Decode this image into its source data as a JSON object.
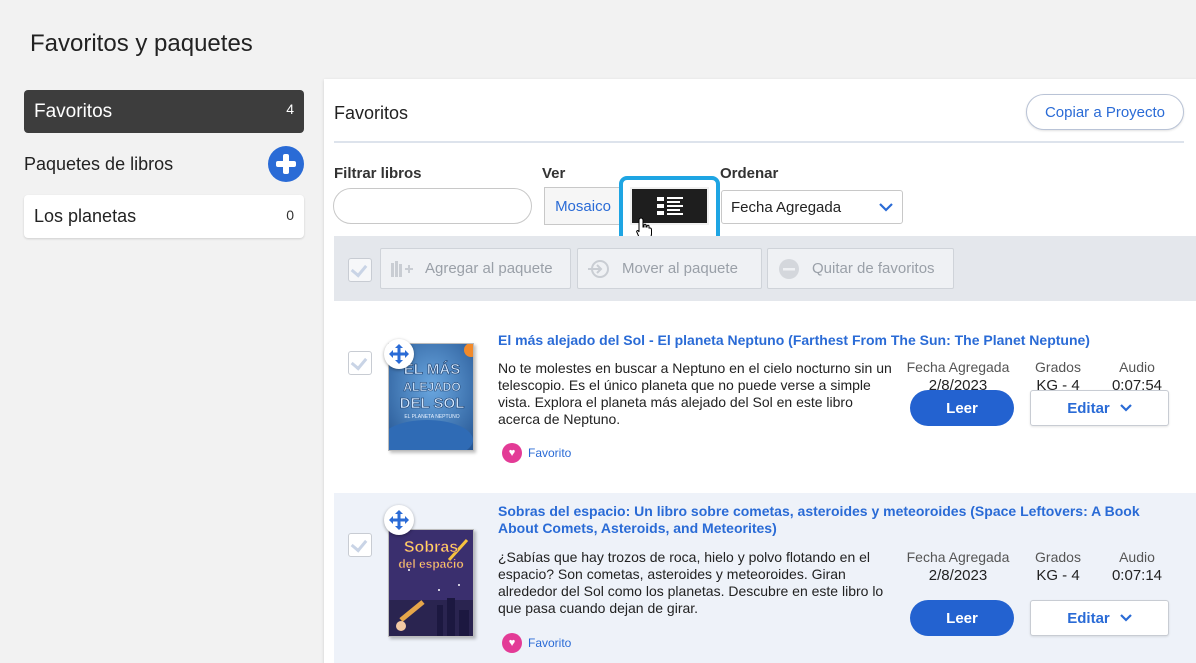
{
  "page": {
    "title": "Favoritos y paquetes"
  },
  "sidebar": {
    "favorites": {
      "label": "Favoritos",
      "count": "4"
    },
    "packages_header": "Paquetes de libros",
    "packages": [
      {
        "label": "Los planetas",
        "count": "0"
      }
    ]
  },
  "main": {
    "title": "Favoritos",
    "copy_button": "Copiar a Proyecto",
    "filter_label": "Filtrar libros",
    "filter_placeholder": "",
    "view_label": "Ver",
    "view_mosaic": "Mosaico",
    "sort_label": "Ordenar",
    "sort_value": "Fecha Agregada",
    "toolbar": {
      "add_to_package": "Agregar al paquete",
      "move_to_package": "Mover al paquete",
      "remove_favorites": "Quitar de favoritos"
    },
    "meta_labels": {
      "date": "Fecha Agregada",
      "grades": "Grados",
      "audio": "Audio"
    },
    "read_label": "Leer",
    "edit_label": "Editar",
    "favorite_tag": "Favorito",
    "books": [
      {
        "title": "El más alejado del Sol - El planeta Neptuno (Farthest From The Sun: The Planet Neptune)",
        "description": "No te molestes en buscar a Neptuno en el cielo nocturno sin un telescopio. Es el único planeta que no puede verse a simple vista. Explora el planeta más alejado del Sol en este libro acerca de Neptuno.",
        "date": "2/8/2023",
        "grades": "KG - 4",
        "audio": "0:07:54",
        "cover_text": [
          "EL MÁS",
          "ALEJADO",
          "DEL SOL",
          "EL PLANETA NEPTUNO"
        ]
      },
      {
        "title": "Sobras del espacio: Un libro sobre cometas, asteroides y meteoroides (Space Leftovers: A Book About Comets, Asteroids, and Meteorites)",
        "description": "¿Sabías que hay trozos de roca, hielo y polvo flotando en el espacio? Son cometas, asteroides y meteoroides. Giran alrededor del Sol como los planetas. Descubre en este libro lo que pasa cuando dejan de girar.",
        "date": "2/8/2023",
        "grades": "KG - 4",
        "audio": "0:07:14",
        "cover_text": [
          "Sobras",
          "del espacio"
        ]
      }
    ]
  },
  "colors": {
    "accent": "#2a6bd6",
    "highlight_ring": "#1ea5e3",
    "favorite_heart": "#e33b96",
    "read_button": "#2362d0"
  }
}
